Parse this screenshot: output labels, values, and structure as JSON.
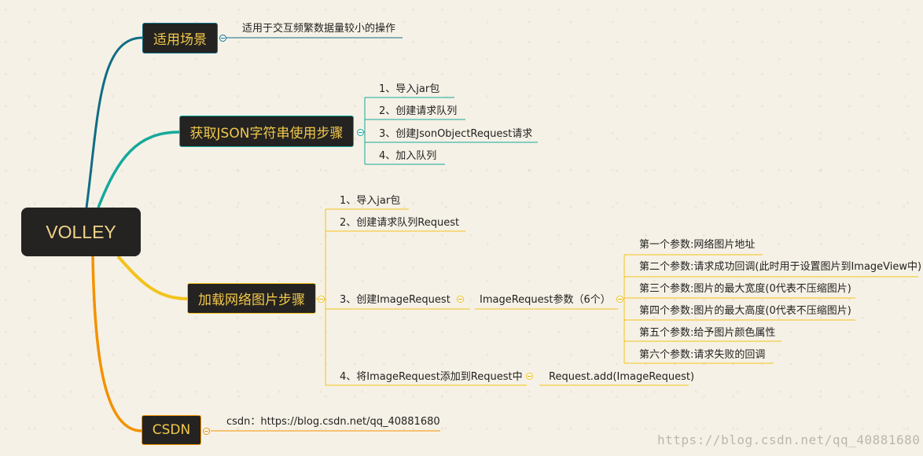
{
  "root": "VOLLEY",
  "branches": {
    "scene": {
      "label": "适用场景",
      "child": "适用于交互频繁数据量较小的操作"
    },
    "json": {
      "label": "获取JSON字符串使用步骤",
      "steps": [
        "1、导入jar包",
        "2、创建请求队列",
        "3、创建JsonObjectRequest请求",
        "4、加入队列"
      ]
    },
    "image": {
      "label": "加载网络图片步骤",
      "steps": [
        "1、导入jar包",
        "2、创建请求队列Request",
        "3、创建ImageRequest",
        "4、将ImageRequest添加到Request中"
      ],
      "params_label": "ImageRequest参数（6个）",
      "params": [
        "第一个参数:网络图片地址",
        "第二个参数:请求成功回调(此时用于设置图片到ImageView中)",
        "第三个参数:图片的最大宽度(0代表不压缩图片)",
        "第四个参数:图片的最大高度(0代表不压缩图片)",
        "第五个参数:给予图片颜色属性",
        "第六个参数:请求失败的回调"
      ],
      "add_call": "Request.add(ImageRequest)"
    },
    "csdn": {
      "label": "CSDN",
      "child": "csdn：https://blog.csdn.net/qq_40881680"
    }
  },
  "watermark": "https://blog.csdn.net/qq_40881680",
  "colors": {
    "scene": "#0f6d86",
    "json": "#14a99c",
    "image": "#f2c31c",
    "csdn": "#f39200",
    "node_bg": "#242321"
  }
}
